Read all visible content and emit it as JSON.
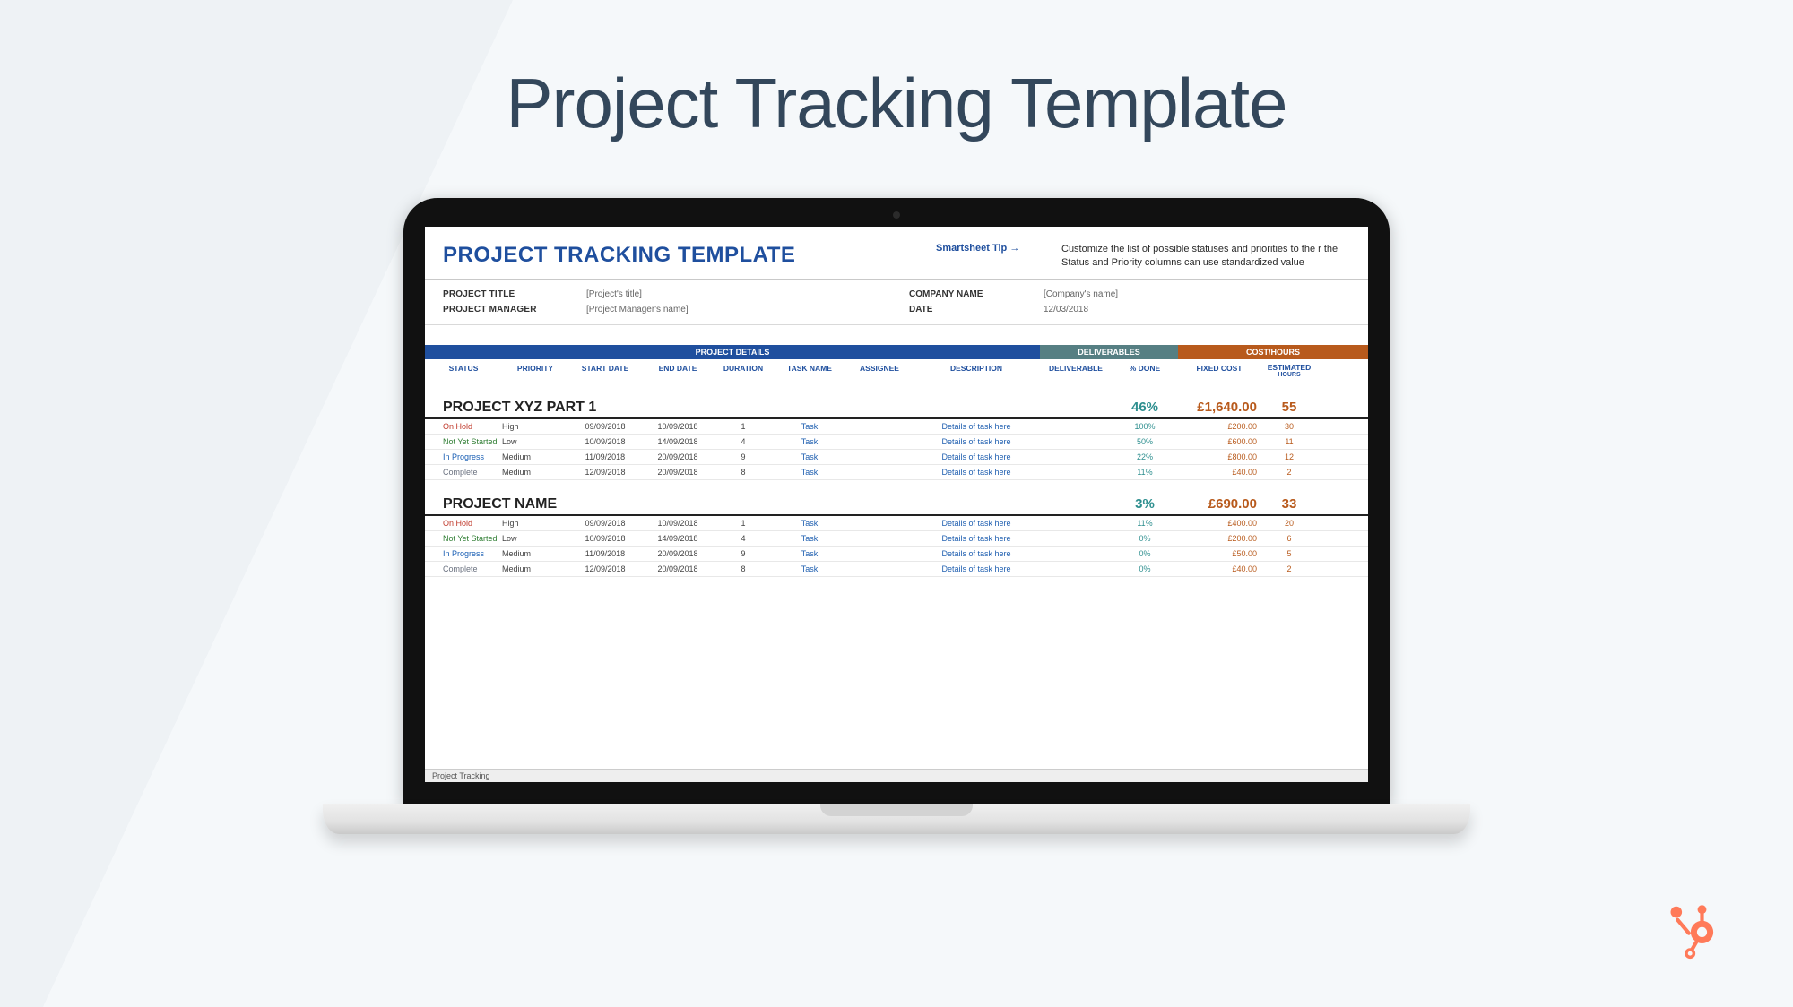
{
  "page_title": "Project Tracking Template",
  "sheet": {
    "title": "PROJECT TRACKING TEMPLATE",
    "tip_label": "Smartsheet Tip →",
    "tip_text": "Customize the list of possible statuses and priorities to the r the Status and Priority columns can use standardized value",
    "meta": {
      "project_title_label": "PROJECT TITLE",
      "project_title_value": "[Project's title]",
      "project_manager_label": "PROJECT MANAGER",
      "project_manager_value": "[Project Manager's name]",
      "company_label": "COMPANY NAME",
      "company_value": "[Company's name]",
      "date_label": "DATE",
      "date_value": "12/03/2018"
    },
    "section_headers": {
      "details": "PROJECT DETAILS",
      "deliverables": "DELIVERABLES",
      "cost": "COST/HOURS"
    },
    "columns": {
      "status": "STATUS",
      "priority": "PRIORITY",
      "start": "START DATE",
      "end": "END DATE",
      "duration": "DURATION",
      "task": "TASK NAME",
      "assignee": "ASSIGNEE",
      "desc": "DESCRIPTION",
      "deliverable": "DELIVERABLE",
      "done": "% DONE",
      "fixed": "FIXED COST",
      "hours_line1": "ESTIMATED",
      "hours_line2": "HOURS"
    },
    "projects": [
      {
        "name": "PROJECT XYZ PART 1",
        "done": "46%",
        "fixed": "£1,640.00",
        "hours": "55",
        "rows": [
          {
            "status": "On Hold",
            "status_cls": "oh",
            "priority": "High",
            "start": "09/09/2018",
            "end": "10/09/2018",
            "dur": "1",
            "task": "Task",
            "desc": "Details of task here",
            "done": "100%",
            "fixed": "£200.00",
            "hours": "30"
          },
          {
            "status": "Not Yet Started",
            "status_cls": "nys",
            "priority": "Low",
            "start": "10/09/2018",
            "end": "14/09/2018",
            "dur": "4",
            "task": "Task",
            "desc": "Details of task here",
            "done": "50%",
            "fixed": "£600.00",
            "hours": "11"
          },
          {
            "status": "In Progress",
            "status_cls": "ip",
            "priority": "Medium",
            "start": "11/09/2018",
            "end": "20/09/2018",
            "dur": "9",
            "task": "Task",
            "desc": "Details of task here",
            "done": "22%",
            "fixed": "£800.00",
            "hours": "12"
          },
          {
            "status": "Complete",
            "status_cls": "comp",
            "priority": "Medium",
            "start": "12/09/2018",
            "end": "20/09/2018",
            "dur": "8",
            "task": "Task",
            "desc": "Details of task here",
            "done": "11%",
            "fixed": "£40.00",
            "hours": "2"
          }
        ]
      },
      {
        "name": "PROJECT NAME",
        "done": "3%",
        "fixed": "£690.00",
        "hours": "33",
        "rows": [
          {
            "status": "On Hold",
            "status_cls": "oh",
            "priority": "High",
            "start": "09/09/2018",
            "end": "10/09/2018",
            "dur": "1",
            "task": "Task",
            "desc": "Details of task here",
            "done": "11%",
            "fixed": "£400.00",
            "hours": "20"
          },
          {
            "status": "Not Yet Started",
            "status_cls": "nys",
            "priority": "Low",
            "start": "10/09/2018",
            "end": "14/09/2018",
            "dur": "4",
            "task": "Task",
            "desc": "Details of task here",
            "done": "0%",
            "fixed": "£200.00",
            "hours": "6"
          },
          {
            "status": "In Progress",
            "status_cls": "ip",
            "priority": "Medium",
            "start": "11/09/2018",
            "end": "20/09/2018",
            "dur": "9",
            "task": "Task",
            "desc": "Details of task here",
            "done": "0%",
            "fixed": "£50.00",
            "hours": "5"
          },
          {
            "status": "Complete",
            "status_cls": "comp",
            "priority": "Medium",
            "start": "12/09/2018",
            "end": "20/09/2018",
            "dur": "8",
            "task": "Task",
            "desc": "Details of task here",
            "done": "0%",
            "fixed": "£40.00",
            "hours": "2"
          }
        ]
      }
    ],
    "tab": "Project Tracking"
  }
}
